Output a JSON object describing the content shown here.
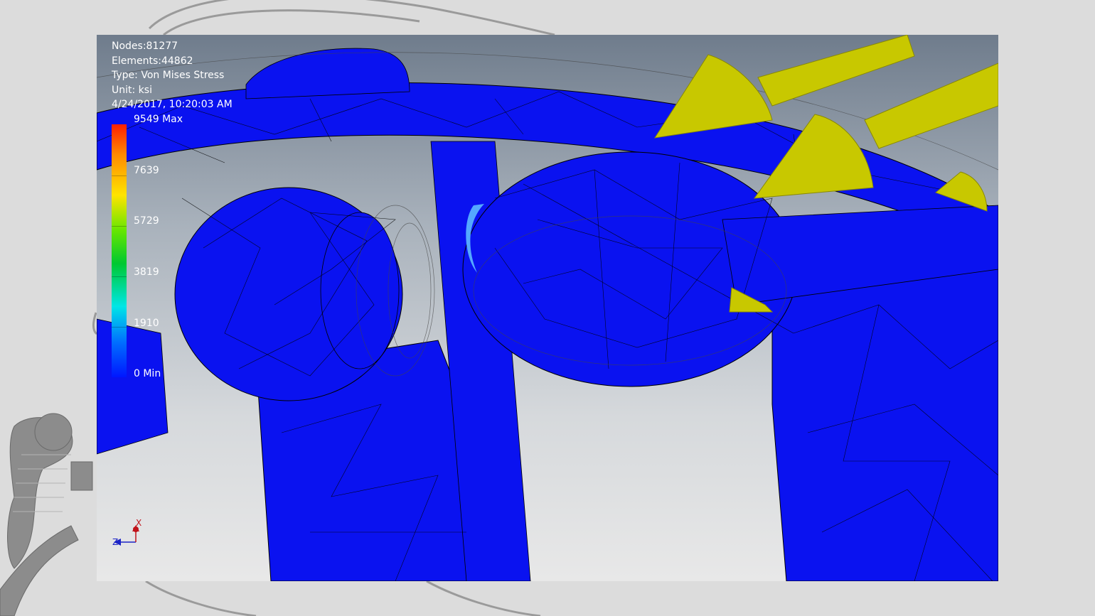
{
  "info": {
    "nodes": "Nodes:81277",
    "elements": "Elements:44862",
    "type": "Type: Von Mises Stress",
    "unit": "Unit: ksi",
    "timestamp": "4/24/2017, 10:20:03 AM"
  },
  "legend": {
    "max_label": "9549 Max",
    "min_label": "0 Min",
    "ticks": [
      "7639",
      "5729",
      "3819",
      "1910"
    ],
    "max_value": 9549,
    "min_value": 0
  },
  "triad": {
    "x_label": "X",
    "z_label": "Z"
  },
  "colors": {
    "mesh_blue": "#0a12f0",
    "load_arrow": "#c8c800",
    "background_gray": "#dcdcdc"
  }
}
